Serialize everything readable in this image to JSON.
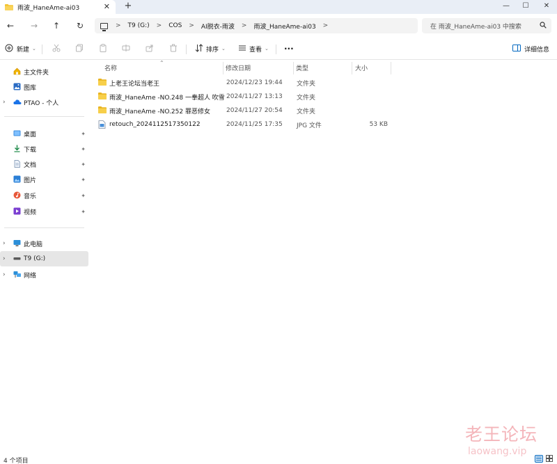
{
  "tab": {
    "title": "雨波_HaneAme-ai03",
    "close": "✕",
    "new_tab": "+"
  },
  "window_controls": {
    "minimize": "—",
    "maximize": "☐",
    "close": "✕"
  },
  "nav": {
    "back": "←",
    "forward": "→",
    "up": "↑",
    "refresh": "↻"
  },
  "breadcrumb": [
    "T9 (G:)",
    "COS",
    "AI脱衣-雨波",
    "雨波_HaneAme-ai03"
  ],
  "breadcrumb_separator": ">",
  "search": {
    "placeholder": "在 雨波_HaneAme-ai03 中搜索"
  },
  "toolbar": {
    "new_label": "新建",
    "sort_label": "排序",
    "view_label": "查看",
    "more_label": "···",
    "details_label": "详细信息"
  },
  "sidebar": {
    "items": [
      {
        "label": "主文件夹",
        "icon": "home-icon",
        "pinned": false
      },
      {
        "label": "图库",
        "icon": "gallery-icon",
        "pinned": false
      },
      {
        "label": "PTAO - 个人",
        "icon": "cloud-icon",
        "pinned": false
      },
      {
        "label": "桌面",
        "icon": "desktop-icon",
        "pinned": true
      },
      {
        "label": "下载",
        "icon": "download-icon",
        "pinned": true
      },
      {
        "label": "文档",
        "icon": "documents-icon",
        "pinned": true
      },
      {
        "label": "图片",
        "icon": "pictures-icon",
        "pinned": true
      },
      {
        "label": "音乐",
        "icon": "music-icon",
        "pinned": true
      },
      {
        "label": "视频",
        "icon": "videos-icon",
        "pinned": true
      },
      {
        "label": "此电脑",
        "icon": "computer-icon",
        "pinned": false
      },
      {
        "label": "T9 (G:)",
        "icon": "drive-icon",
        "pinned": false
      },
      {
        "label": "网络",
        "icon": "network-icon",
        "pinned": false
      }
    ],
    "pin_glyph": "📌"
  },
  "columns": {
    "name": "名称",
    "modified": "修改日期",
    "type": "类型",
    "size": "大小"
  },
  "files": [
    {
      "name": "上老王论坛当老王",
      "modified": "2024/12/23 19:44",
      "type": "文件夹",
      "size": "",
      "icon": "folder-icon"
    },
    {
      "name": "雨波_HaneAme -NO.248 一拳超人 吹雪",
      "modified": "2024/11/27 13:13",
      "type": "文件夹",
      "size": "",
      "icon": "folder-icon"
    },
    {
      "name": "雨波_HaneAme -NO.252 罪恶修女",
      "modified": "2024/11/27 20:54",
      "type": "文件夹",
      "size": "",
      "icon": "folder-icon"
    },
    {
      "name": "retouch_2024112517350122",
      "modified": "2024/11/25 17:35",
      "type": "JPG 文件",
      "size": "53 KB",
      "icon": "image-file-icon"
    }
  ],
  "status": {
    "item_count": "4 个项目"
  },
  "watermark": {
    "line1": "老王论坛",
    "line2": "laowang.vip"
  },
  "colors": {
    "folder": "#f4c430",
    "selected_bg": "#e6e6e6",
    "titlebar_bg": "#e9eef6",
    "accent": "#0067c0",
    "watermark": "#eb7882"
  }
}
